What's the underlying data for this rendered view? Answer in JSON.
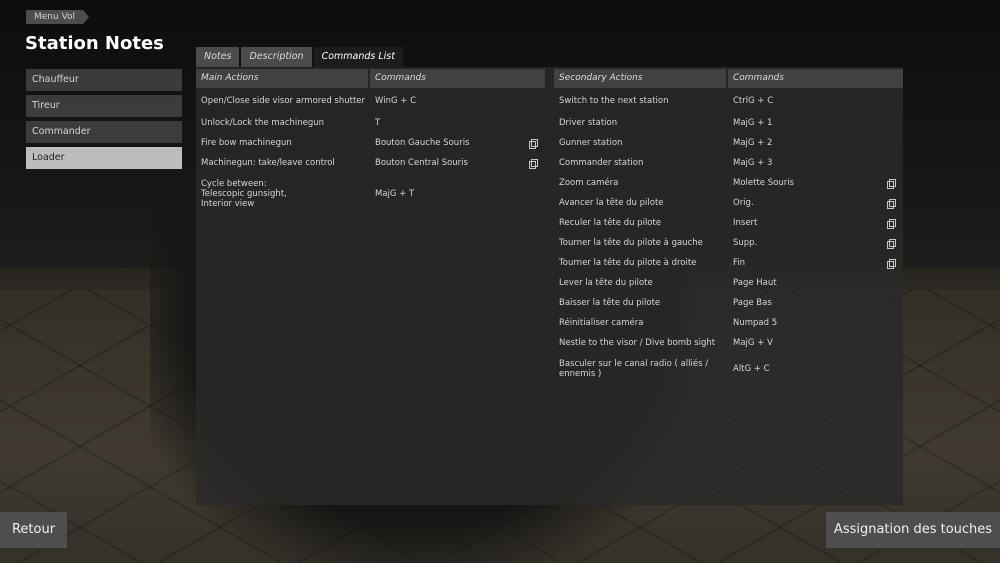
{
  "breadcrumb": "Menu Vol",
  "page_title": "Station Notes",
  "stations": [
    "Chauffeur",
    "Tireur",
    "Commander",
    "Loader"
  ],
  "active_station": "Loader",
  "tabs": [
    {
      "label": "Notes",
      "active": false
    },
    {
      "label": "Description",
      "active": false
    },
    {
      "label": "Commands List",
      "active": true
    }
  ],
  "main": {
    "header_action": "Main Actions",
    "header_command": "Commands",
    "rows": [
      {
        "action": "Open/Close side visor armored shutter",
        "command": "WinG + C",
        "copy": false
      },
      {
        "action": "Unlock/Lock the machinegun",
        "command": "T",
        "copy": false
      },
      {
        "action": "Fire bow machinegun",
        "command": "Bouton Gauche Souris",
        "copy": true
      },
      {
        "action": "Machinegun: take/leave control",
        "command": "Bouton Central Souris",
        "copy": true
      },
      {
        "action": "Cycle between:\nTelescopic gunsight,\nInterior view",
        "command": "MajG + T",
        "copy": false
      }
    ]
  },
  "secondary": {
    "header_action": "Secondary Actions",
    "header_command": "Commands",
    "rows": [
      {
        "action": "Switch to the next station",
        "command": "CtrlG + C",
        "copy": false
      },
      {
        "action": "Driver station",
        "command": "MajG + 1",
        "copy": false
      },
      {
        "action": "Gunner station",
        "command": "MajG + 2",
        "copy": false
      },
      {
        "action": "Commander station",
        "command": "MajG + 3",
        "copy": false
      },
      {
        "action": "Zoom caméra",
        "command": "Molette Souris",
        "copy": true
      },
      {
        "action": "Avancer la tête du pilote",
        "command": "Orig.",
        "copy": true
      },
      {
        "action": "Reculer la tête du pilote",
        "command": "Insert",
        "copy": true
      },
      {
        "action": "Tourner la tête du pilote à gauche",
        "command": "Supp.",
        "copy": true
      },
      {
        "action": "Tourner la tête du pilote à droite",
        "command": "Fin",
        "copy": true
      },
      {
        "action": "Lever la tête du pilote",
        "command": "Page Haut",
        "copy": false
      },
      {
        "action": "Baisser la tête du pilote",
        "command": "Page Bas",
        "copy": false
      },
      {
        "action": "Réinitialiser caméra",
        "command": "Numpad 5",
        "copy": false
      },
      {
        "action": "Nestle to the visor / Dive bomb sight",
        "command": "MajG + V",
        "copy": false
      },
      {
        "action": "Basculer sur le canal radio ( alliés /\nennemis )",
        "command": "AltG + C",
        "copy": false
      }
    ]
  },
  "buttons": {
    "back": "Retour",
    "key_assignment": "Assignation des touches"
  },
  "icons": {
    "copy": "duplicate-binding-icon"
  }
}
